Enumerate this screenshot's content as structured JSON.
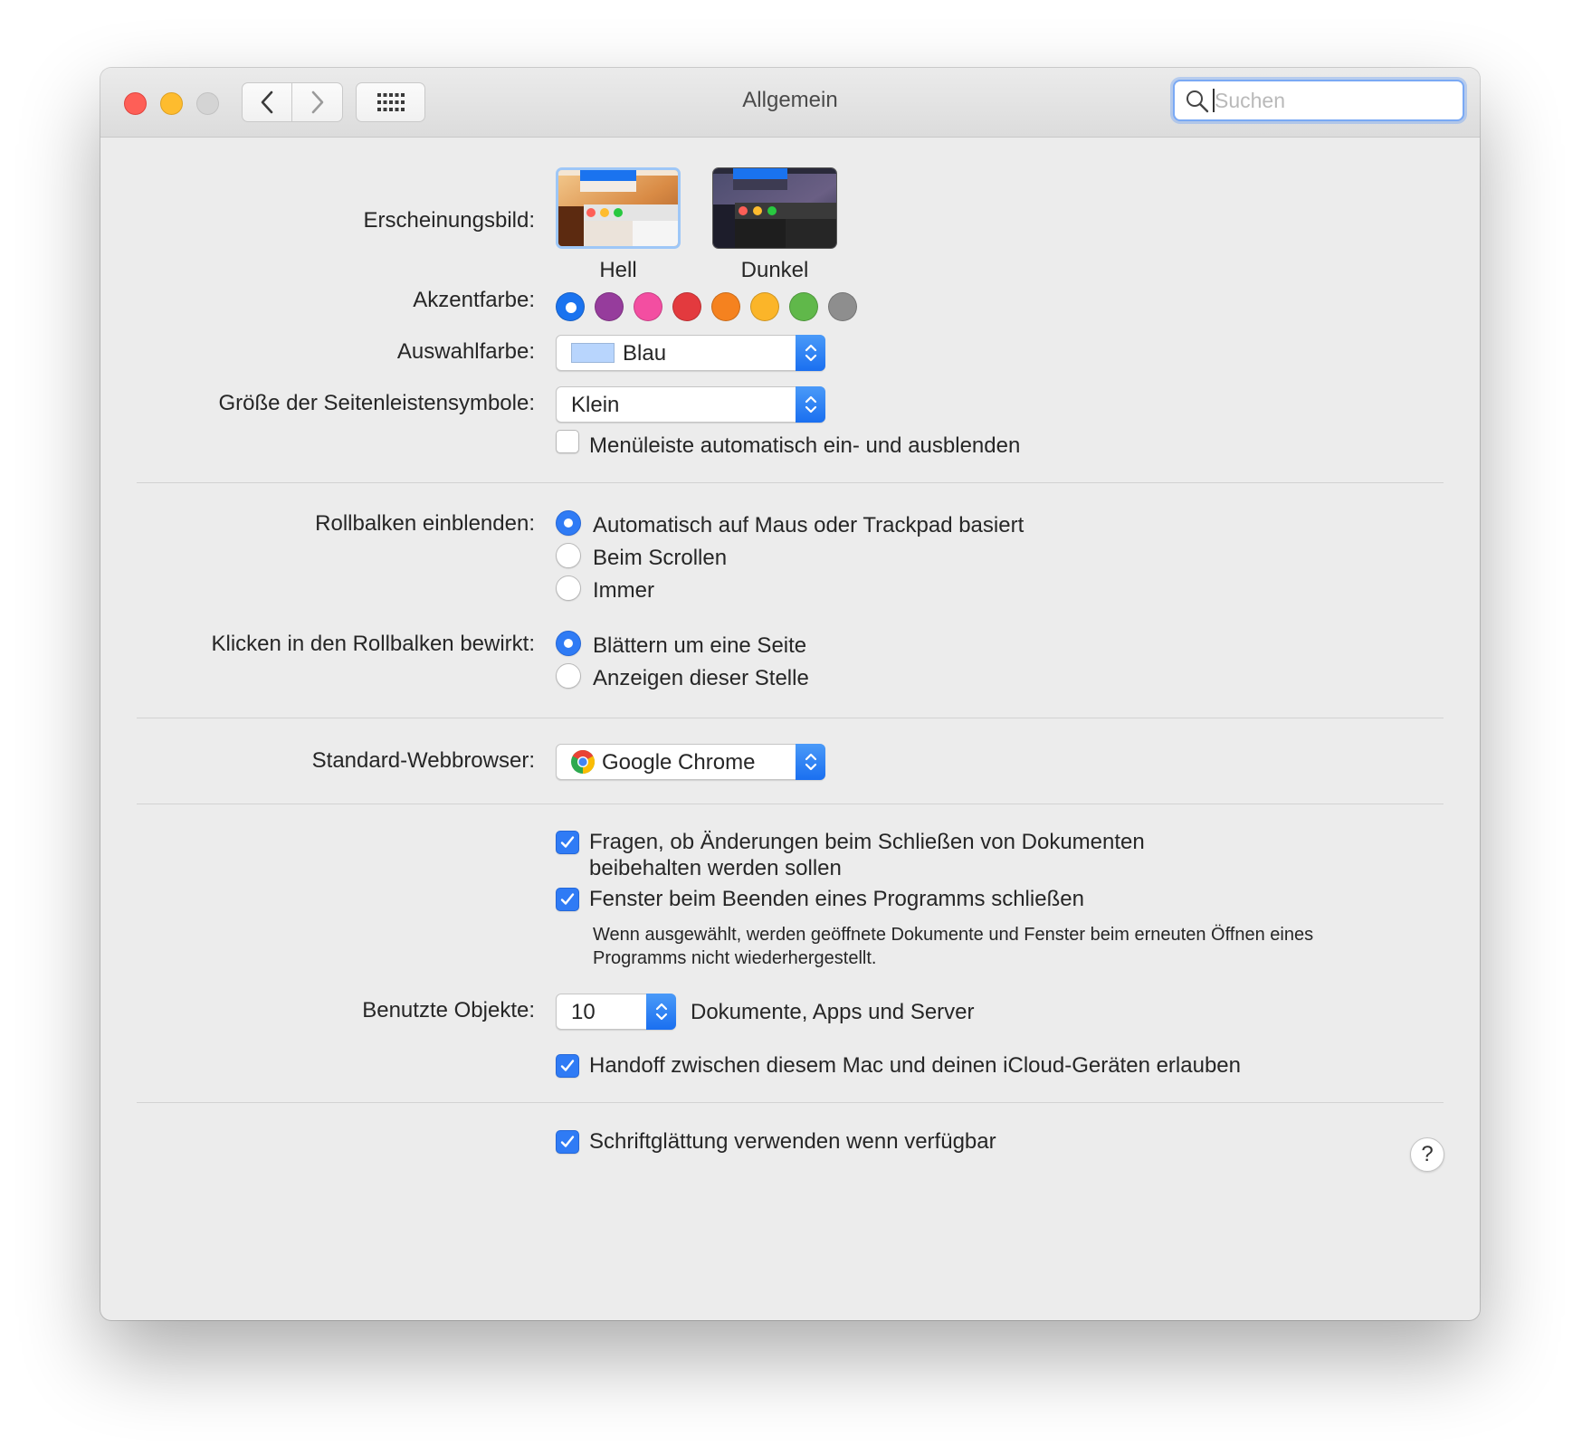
{
  "window": {
    "title": "Allgemein"
  },
  "search": {
    "placeholder": "Suchen"
  },
  "appearance": {
    "label": "Erscheinungsbild:",
    "options": [
      {
        "label": "Hell",
        "selected": true
      },
      {
        "label": "Dunkel",
        "selected": false
      }
    ]
  },
  "accent": {
    "label": "Akzentfarbe:",
    "colors": [
      "#1a73ef",
      "#963c9c",
      "#f34ea1",
      "#e33a3e",
      "#f5821f",
      "#fbb529",
      "#60b84a",
      "#8e8e8e"
    ],
    "selected_index": 0
  },
  "highlight": {
    "label": "Auswahlfarbe:",
    "value": "Blau",
    "swatch": "#b8d5fd"
  },
  "sidebar_size": {
    "label": "Größe der Seitenleistensymbole:",
    "value": "Klein"
  },
  "menubar": {
    "label": "Menüleiste automatisch ein- und ausblenden",
    "checked": false
  },
  "scrollbars": {
    "label": "Rollbalken einblenden:",
    "options": [
      "Automatisch auf Maus oder Trackpad basiert",
      "Beim Scrollen",
      "Immer"
    ],
    "selected_index": 0
  },
  "click_scroll": {
    "label": "Klicken in den Rollbalken bewirkt:",
    "options": [
      "Blättern um eine Seite",
      "Anzeigen dieser Stelle"
    ],
    "selected_index": 0
  },
  "browser": {
    "label": "Standard-Webbrowser:",
    "value": "Google Chrome"
  },
  "ask_keep": {
    "line1": "Fragen, ob Änderungen beim Schließen von Dokumenten",
    "line2": "beibehalten werden sollen",
    "checked": true
  },
  "close_windows": {
    "label": "Fenster beim Beenden eines Programms schließen",
    "checked": true,
    "note_line1": "Wenn ausgewählt, werden geöffnete Dokumente und Fenster beim erneuten Öffnen eines",
    "note_line2": "Programms nicht wiederhergestellt."
  },
  "recent": {
    "label": "Benutzte Objekte:",
    "value": "10",
    "suffix": "Dokumente, Apps und Server"
  },
  "handoff": {
    "label": "Handoff zwischen diesem Mac und deinen iCloud-Geräten erlauben",
    "checked": true
  },
  "font_smoothing": {
    "label": "Schriftglättung verwenden wenn verfügbar",
    "checked": true
  },
  "help": {
    "label": "?"
  }
}
